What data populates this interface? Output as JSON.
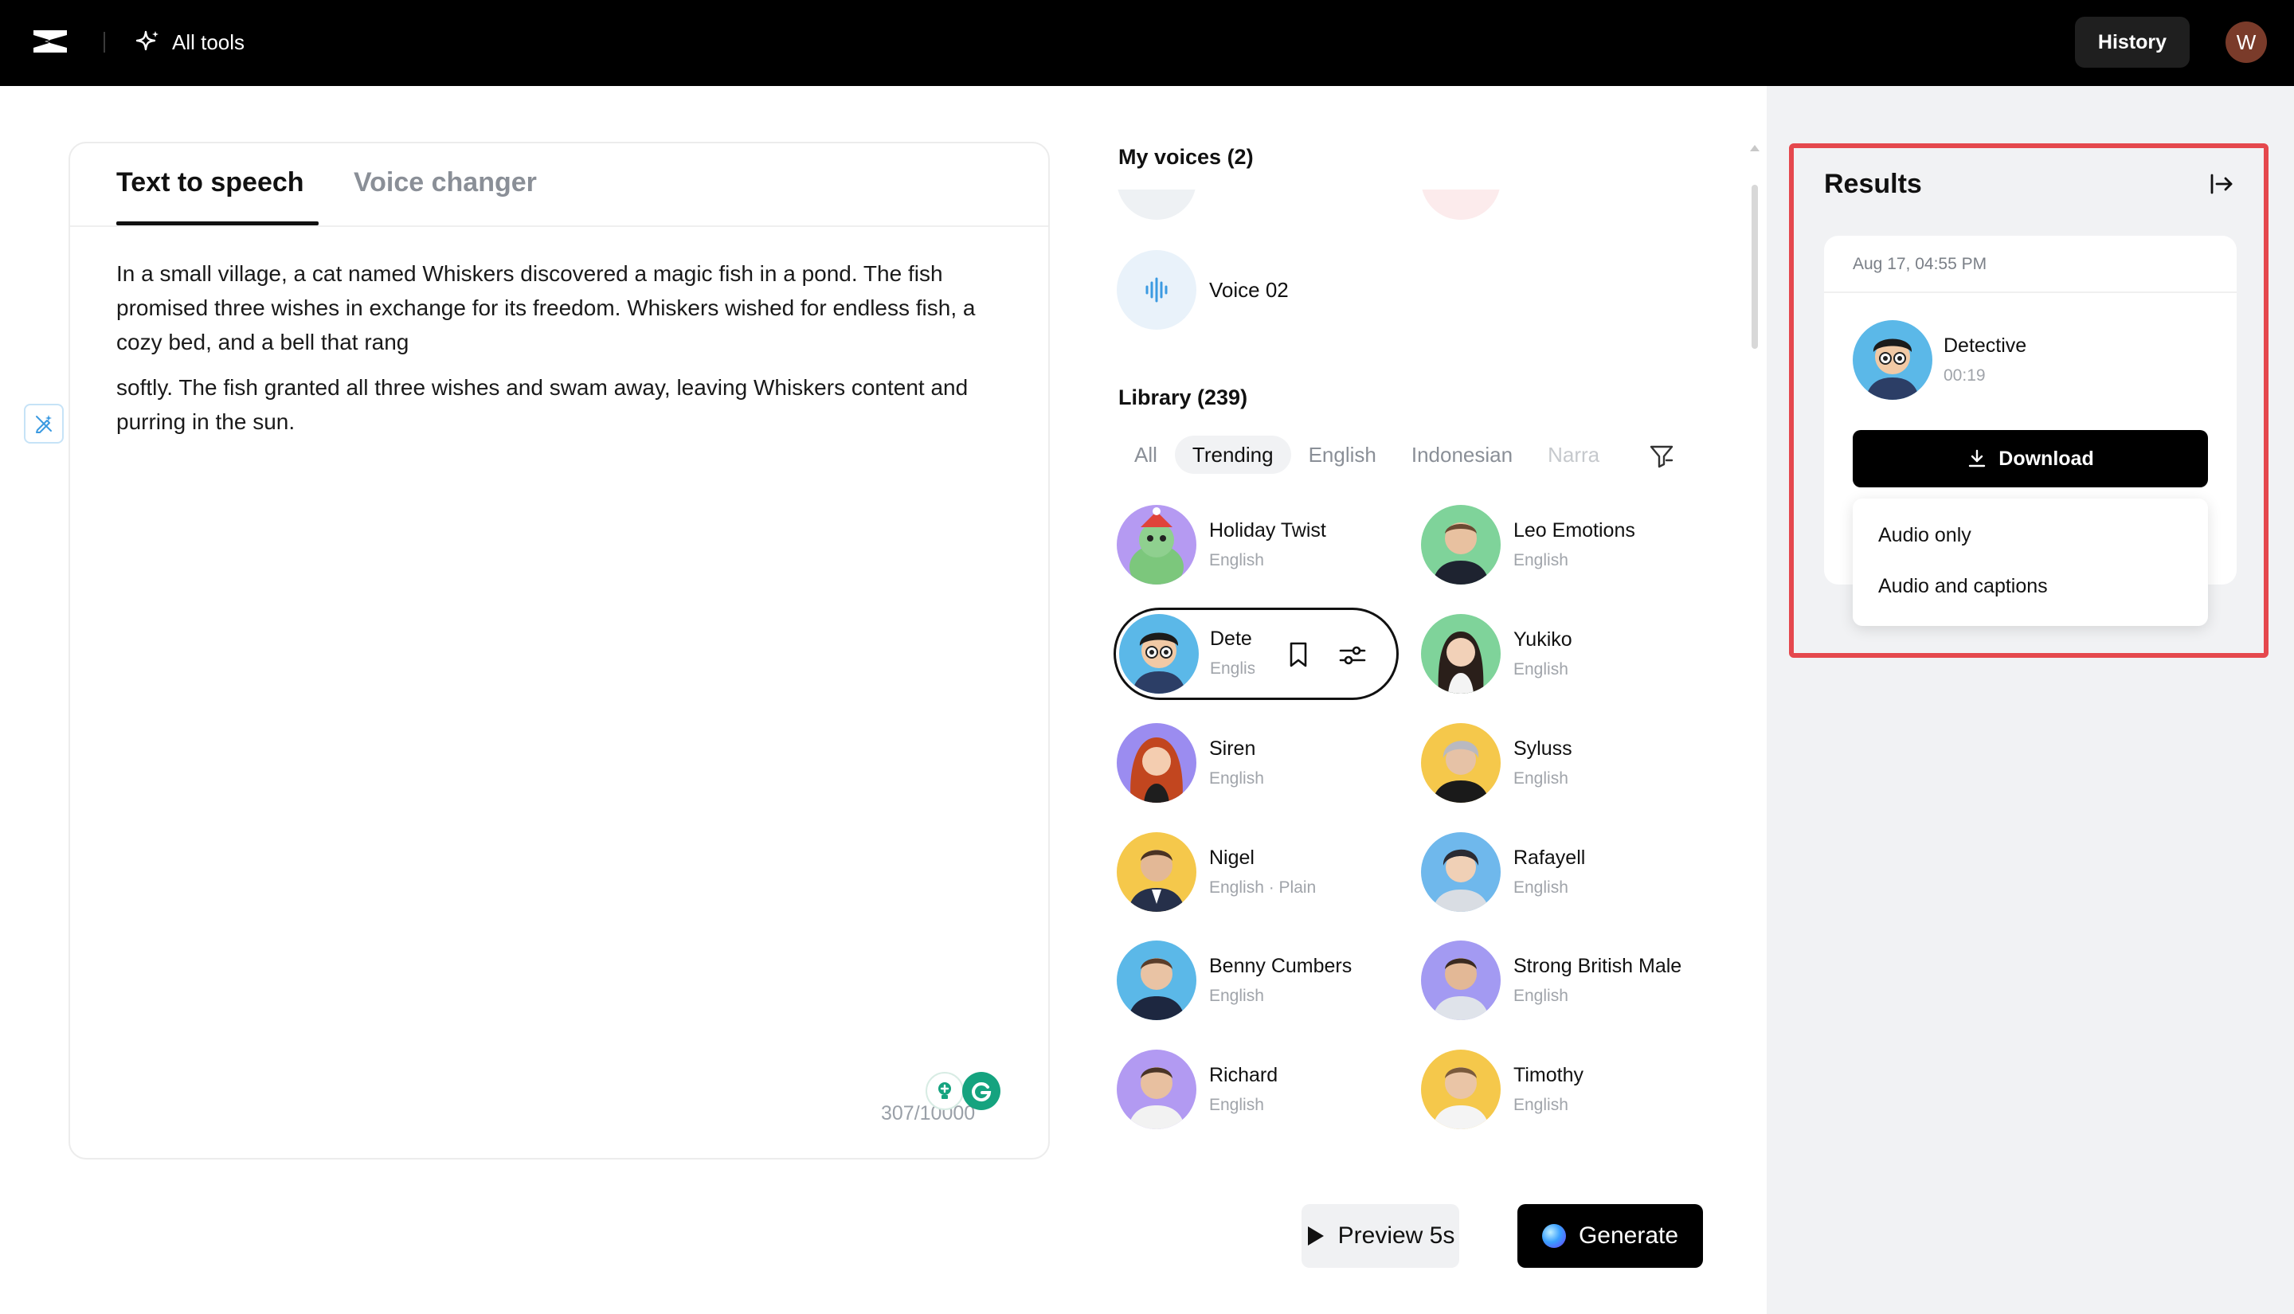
{
  "header": {
    "all_tools_label": "All tools",
    "history_label": "History",
    "user_initial": "W"
  },
  "editor": {
    "tabs": [
      {
        "label": "Text to speech",
        "active": true
      },
      {
        "label": "Voice changer",
        "active": false
      }
    ],
    "paragraphs": [
      "In a small village, a cat named Whiskers discovered a magic fish in a pond. The fish promised three wishes in exchange for its freedom. Whiskers wished for endless fish, a cozy bed, and a bell that rang",
      "softly. The fish granted all three wishes and swam away, leaving Whiskers content and purring in the sun."
    ],
    "char_count": "307/10000"
  },
  "my_voices": {
    "title": "My voices (2)",
    "items": [
      {
        "name": "Voice 02"
      }
    ]
  },
  "library": {
    "title": "Library (239)",
    "filters": [
      "All",
      "Trending",
      "English",
      "Indonesian",
      "Narra"
    ],
    "active_filter": "Trending",
    "voices": [
      {
        "name": "Holiday Twist",
        "lang": "English"
      },
      {
        "name": "Leo Emotions",
        "lang": "English"
      },
      {
        "name": "Dete",
        "lang": "Englis",
        "selected": true
      },
      {
        "name": "Yukiko",
        "lang": "English"
      },
      {
        "name": "Siren",
        "lang": "English"
      },
      {
        "name": "Syluss",
        "lang": "English"
      },
      {
        "name": "Nigel",
        "lang": "English · Plain"
      },
      {
        "name": "Rafayell",
        "lang": "English"
      },
      {
        "name": "Benny Cumbers",
        "lang": "English"
      },
      {
        "name": "Strong British Male",
        "lang": "English"
      },
      {
        "name": "Richard",
        "lang": "English"
      },
      {
        "name": "Timothy",
        "lang": "English"
      }
    ]
  },
  "actions": {
    "preview_label": "Preview 5s",
    "generate_label": "Generate"
  },
  "results": {
    "title": "Results",
    "card": {
      "date": "Aug 17, 04:55 PM",
      "voice_name": "Detective",
      "duration": "00:19",
      "download_label": "Download"
    },
    "download_menu": [
      "Audio only",
      "Audio and captions"
    ]
  },
  "colors": {
    "accent_highlight": "#e5484d",
    "topbar": "#000000",
    "panel_bg": "#f1f2f4"
  }
}
